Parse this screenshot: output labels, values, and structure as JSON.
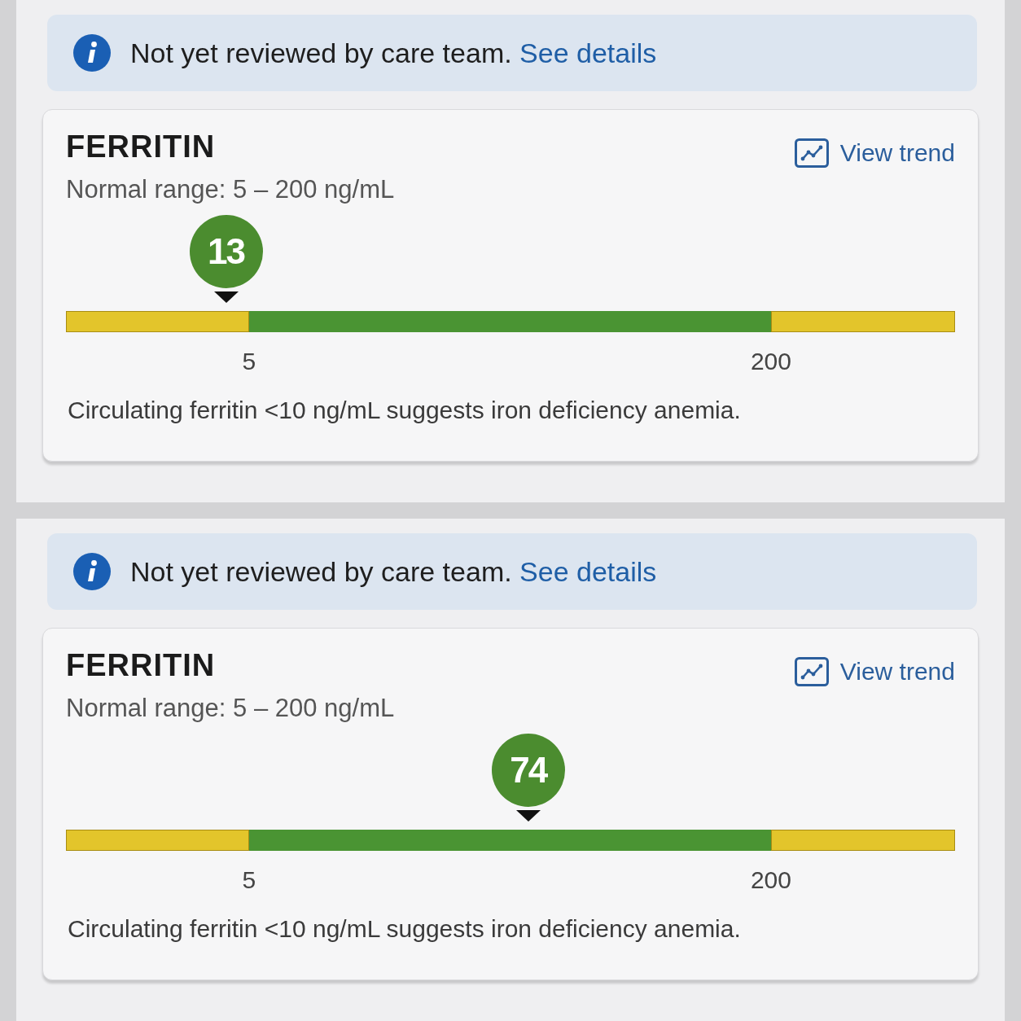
{
  "panels": [
    {
      "notice": {
        "text": "Not yet reviewed by care team.",
        "link": "See details"
      },
      "card": {
        "title": "FERRITIN",
        "normal_range": "Normal range: 5 – 200 ng/mL",
        "trend_link": "View trend",
        "result": {
          "value": "13",
          "level": 0.18
        },
        "range_bar": {
          "segments": [
            {
              "color": "#e3c52b"
            },
            {
              "color": "#4a9433"
            },
            {
              "color": "#e3c52b"
            }
          ],
          "ticks": [
            "5",
            "200"
          ]
        },
        "note": "Circulating ferritin <10 ng/mL suggests iron deficiency anemia."
      }
    },
    {
      "notice": {
        "text": "Not yet reviewed by care team.",
        "link": "See details"
      },
      "card": {
        "title": "FERRITIN",
        "normal_range": "Normal range: 5 – 200 ng/mL",
        "trend_link": "View trend",
        "result": {
          "value": "74",
          "level": 0.52
        },
        "range_bar": {
          "segments": [
            {
              "color": "#e3c52b"
            },
            {
              "color": "#4a9433"
            },
            {
              "color": "#e3c52b"
            }
          ],
          "ticks": [
            "5",
            "200"
          ]
        },
        "note": "Circulating ferritin <10 ng/mL suggests iron deficiency anemia."
      }
    }
  ]
}
